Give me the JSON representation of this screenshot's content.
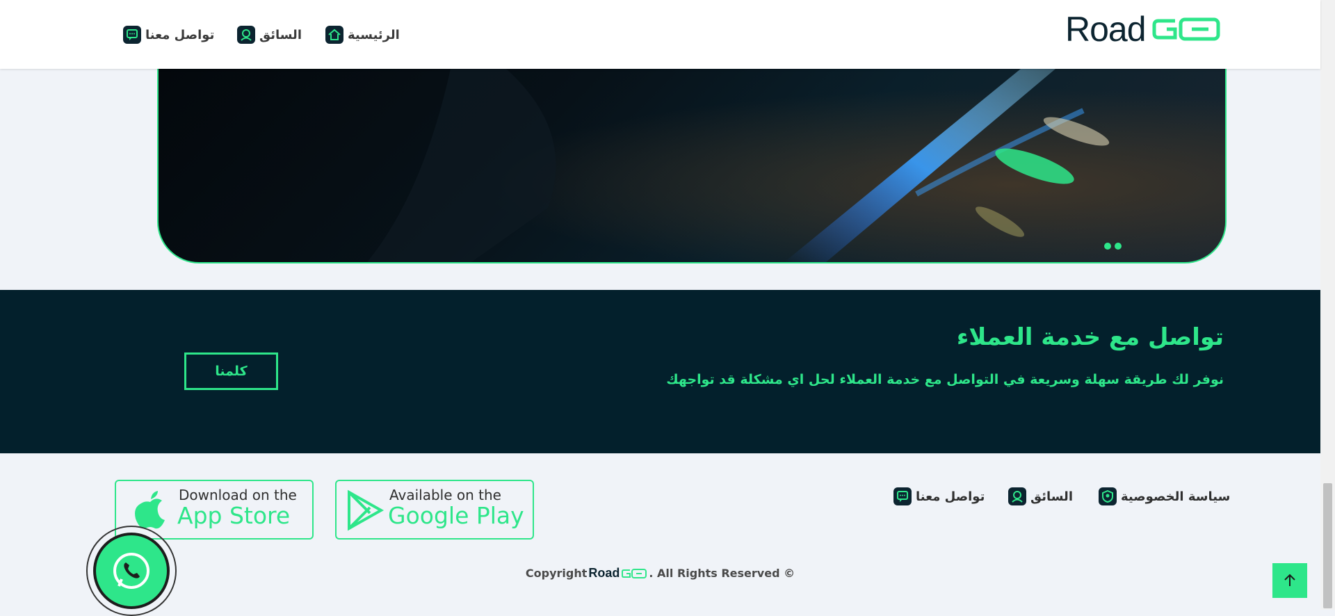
{
  "header": {
    "logo_word": "Road",
    "logo_mark": "G",
    "nav": [
      {
        "label": "الرئيسية",
        "icon": "home-icon"
      },
      {
        "label": "السائق",
        "icon": "driver-icon"
      },
      {
        "label": "تواصل معنا",
        "icon": "chat-icon"
      }
    ]
  },
  "hero": {
    "image": "dark car interior photo"
  },
  "cta": {
    "title": "تواصل مع خدمة العملاء",
    "subtitle": "نوفر لك طريقة سهلة وسريعة في التواصل مع خدمة العملاء لحل اي مشكلة قد تواجهك",
    "button": "كلمنا"
  },
  "footer": {
    "links": [
      {
        "label": "سياسة الخصوصية",
        "icon": "shield-icon"
      },
      {
        "label": "السائق",
        "icon": "driver-icon"
      },
      {
        "label": "تواصل معنا",
        "icon": "chat-icon"
      }
    ],
    "google_play": {
      "small": "Available on the",
      "big": "Google Play"
    },
    "app_store": {
      "small": "Download on the",
      "big": "App Store"
    },
    "copyright_prefix": "Copyright",
    "copyright_brand": "Road",
    "copyright_suffix": ". All Rights Reserved ©"
  },
  "colors": {
    "accent": "#2ee68a",
    "dark": "#03202c",
    "bg": "#f0f3f8"
  }
}
